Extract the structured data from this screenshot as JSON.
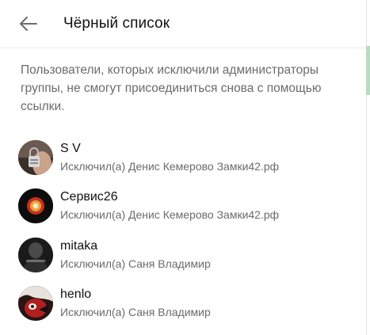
{
  "header": {
    "title": "Чёрный список",
    "back_icon": "arrow-left-icon"
  },
  "description": "Пользователи, которых исключили администраторы группы, не смогут присоединиться снова с помощью ссылки.",
  "users": [
    {
      "name": "S V",
      "removed_by": "Исключил(а) Денис Кемерово Замки42.рф",
      "avatar": "padlock-avatar"
    },
    {
      "name": "Сервис26",
      "removed_by": "Исключил(а) Денис Кемерово Замки42.рф",
      "avatar": "red-badge-avatar"
    },
    {
      "name": "mitaka",
      "removed_by": "Исключил(а) Саня Владимир",
      "avatar": "dark-figure-avatar"
    },
    {
      "name": "henlo",
      "removed_by": "Исключил(а) Саня Владимир",
      "avatar": "anime-red-avatar"
    }
  ]
}
